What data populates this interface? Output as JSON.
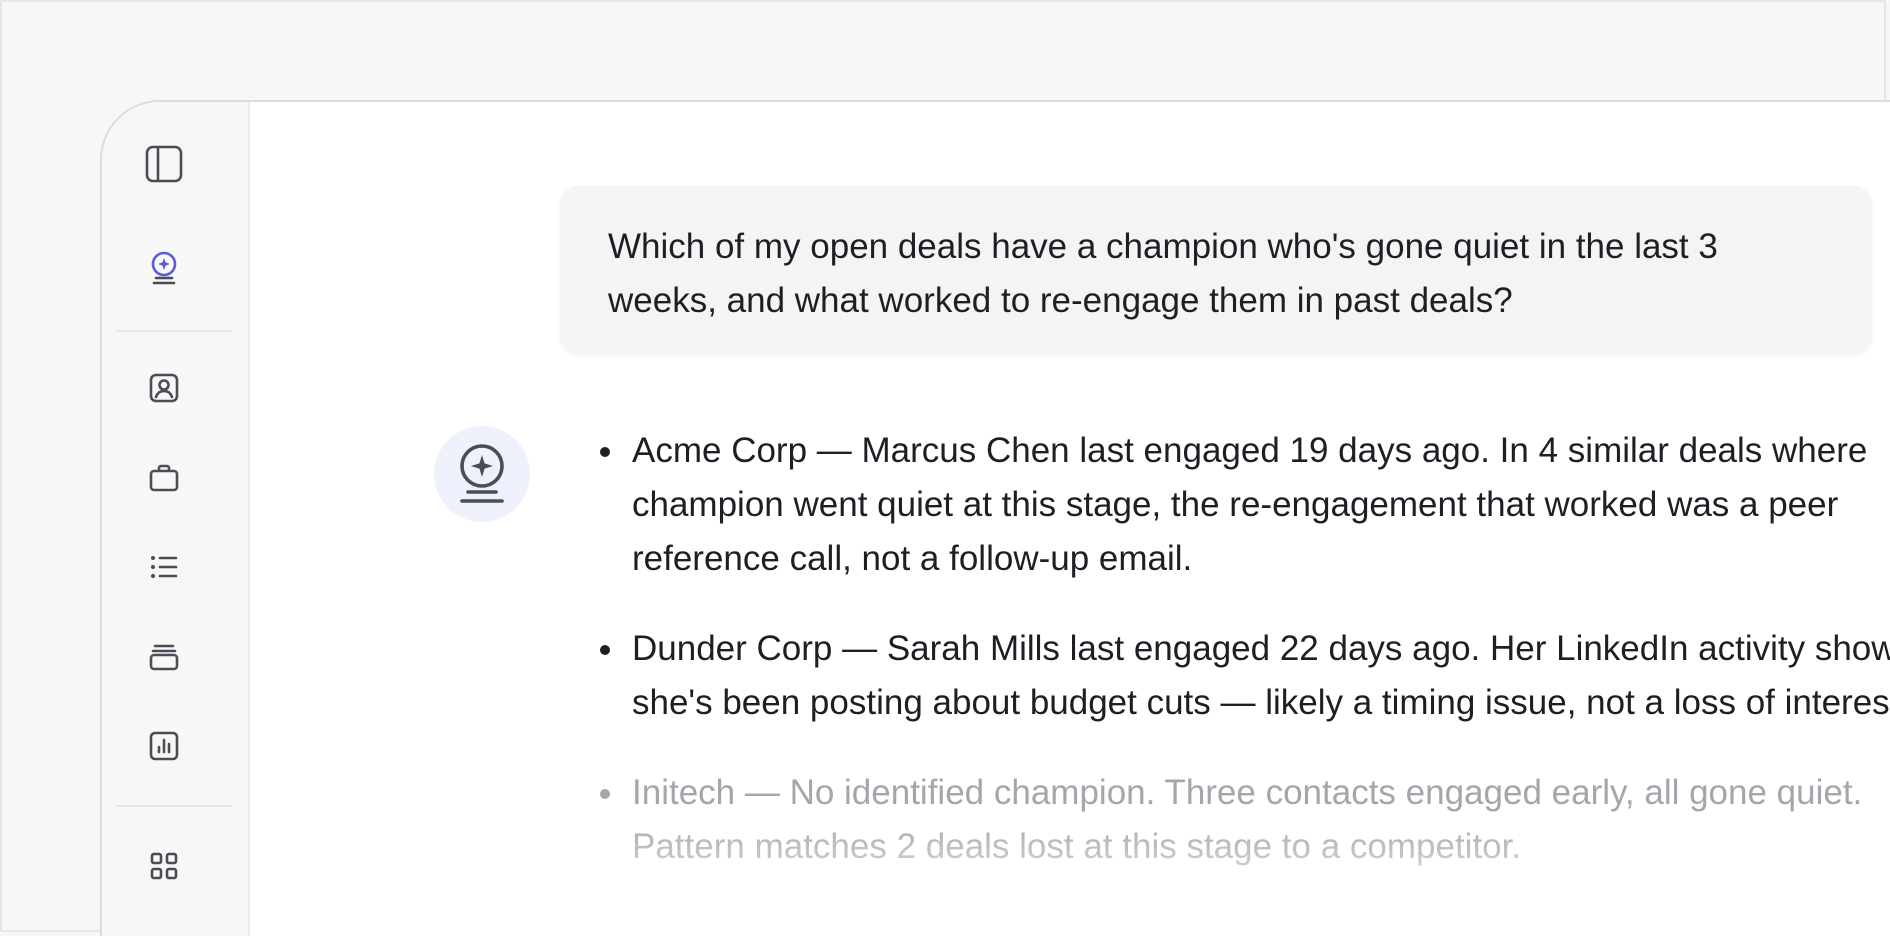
{
  "sidebar": {
    "icons": [
      {
        "name": "sidebar-toggle-icon"
      },
      {
        "name": "assistant-orb-icon",
        "accent": "#5b5bd6"
      },
      {
        "name": "contact-card-icon"
      },
      {
        "name": "briefcase-icon"
      },
      {
        "name": "list-icon"
      },
      {
        "name": "stack-icon"
      },
      {
        "name": "chart-icon"
      },
      {
        "name": "grid-apps-icon"
      }
    ]
  },
  "conversation": {
    "user_message": "Which of my open deals have a champion who's gone quiet in the last 3 weeks, and what worked to re-engage them in past deals?",
    "assistant_avatar_icon": "assistant-orb-icon",
    "response_items": [
      {
        "text": "Acme Corp — Marcus Chen last engaged 19 days ago. In 4 similar deals where champion went quiet at this stage, the re-engagement that worked was a peer reference call, not a follow-up email."
      },
      {
        "text": "Dunder Corp — Sarah Mills last engaged 22 days ago. Her LinkedIn activity shows she's been posting about budget cuts — likely a timing issue, not a loss of interest."
      },
      {
        "text": "Initech — No identified champion. Three contacts engaged early, all gone quiet. Pattern matches 2 deals lost at this stage to a competitor."
      }
    ]
  },
  "colors": {
    "accent": "#5b5bd6",
    "text_primary": "#1d1f24",
    "text_faded": "#a4a6ab",
    "bubble_bg": "#f4f4f5",
    "avatar_bg": "#eef1fb"
  }
}
